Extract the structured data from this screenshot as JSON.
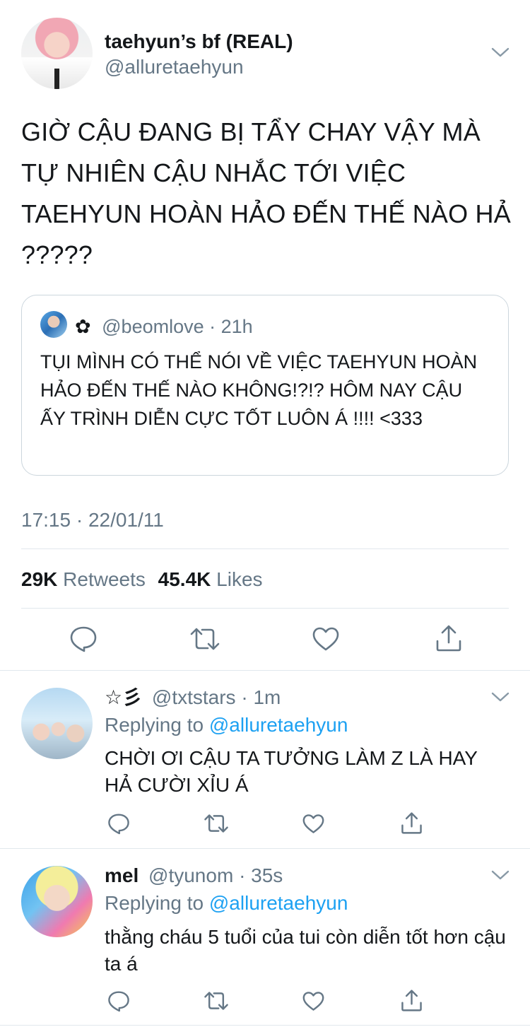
{
  "main_tweet": {
    "display_name": "taehyun’s bf (REAL)",
    "handle": "@alluretaehyun",
    "text": "GIỜ CẬU ĐANG BỊ TẨY CHAY VẬY MÀ TỰ NHIÊN CẬU NHẮC TỚI VIỆC TAEHYUN HOÀN HẢO ĐẾN THẾ NÀO HẢ ?????",
    "quoted": {
      "display_name": "✿",
      "handle": "@beomlove",
      "time": "· 21h",
      "text": "TỤI MÌNH CÓ THỂ NÓI VỀ VIỆC TAEHYUN HOÀN HẢO ĐẾN THẾ NÀO KHÔNG!?!? HÔM NAY CẬU ẤY TRÌNH DIỄN CỰC TỐT LUÔN Á !!!! <333"
    },
    "timestamp": "17:15 · 22/01/11",
    "stats": {
      "retweets_count": "29K",
      "retweets_label": "Retweets",
      "likes_count": "45.4K",
      "likes_label": "Likes"
    }
  },
  "replies": [
    {
      "display_name": "☆彡",
      "handle": "@txtstars",
      "time": "· 1m",
      "replying_prefix": "Replying to",
      "replying_to": "@alluretaehyun",
      "text": "CHỜI ƠI CẬU TA TƯỞNG LÀM Z LÀ HAY HẢ CƯỜI XỈU Á"
    },
    {
      "display_name": "mel",
      "handle": "@tyunom",
      "time": "· 35s",
      "replying_prefix": "Replying to",
      "replying_to": "@alluretaehyun",
      "text": "thằng cháu 5 tuổi của tui còn diễn tốt hơn cậu ta á"
    }
  ],
  "icons": {
    "reply": "reply-icon",
    "retweet": "retweet-icon",
    "like": "heart-icon",
    "share": "share-icon",
    "menu": "chevron-down-icon"
  },
  "colors": {
    "text": "#14171a",
    "secondary": "#657786",
    "link": "#1da1f2",
    "divider": "#e1e8ed"
  }
}
